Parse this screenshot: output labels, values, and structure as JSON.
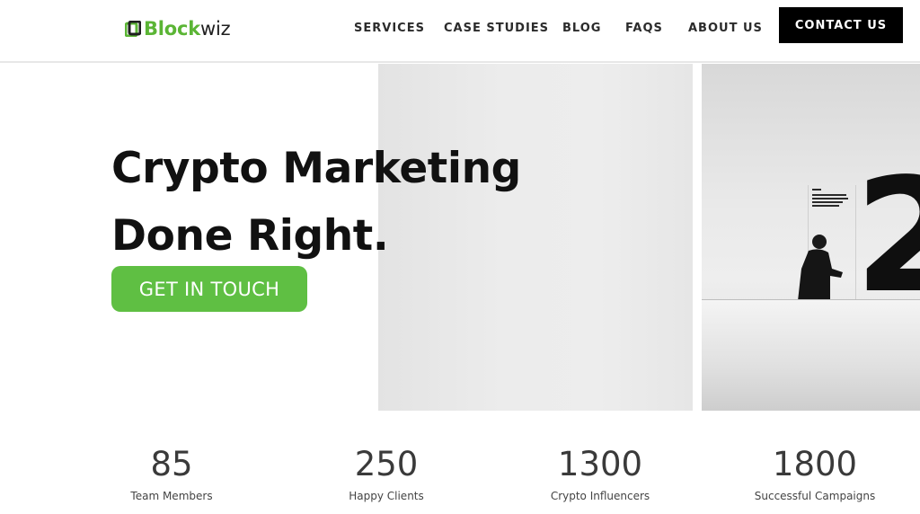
{
  "header": {
    "logo": {
      "part1": "Block",
      "part2": "wiz",
      "icon": "blockwiz-logo-icon"
    },
    "nav": [
      {
        "label": "SERVICES"
      },
      {
        "label": "CASE STUDIES"
      },
      {
        "label": "BLOG"
      },
      {
        "label": "FAQS"
      },
      {
        "label": "ABOUT US"
      }
    ],
    "contact_label": "CONTACT US"
  },
  "hero": {
    "title_line1": "Crypto Marketing",
    "title_line2": "Done Right.",
    "cta_label": "GET IN TOUCH",
    "image_numeral": "2"
  },
  "stats": [
    {
      "value": "85",
      "label": "Team Members"
    },
    {
      "value": "250",
      "label": "Happy Clients"
    },
    {
      "value": "1300",
      "label": "Crypto Influencers"
    },
    {
      "value": "1800",
      "label": "Successful Campaigns"
    }
  ],
  "colors": {
    "accent": "#5fbf43",
    "brand_green": "#5bb535",
    "button_dark": "#000000"
  }
}
